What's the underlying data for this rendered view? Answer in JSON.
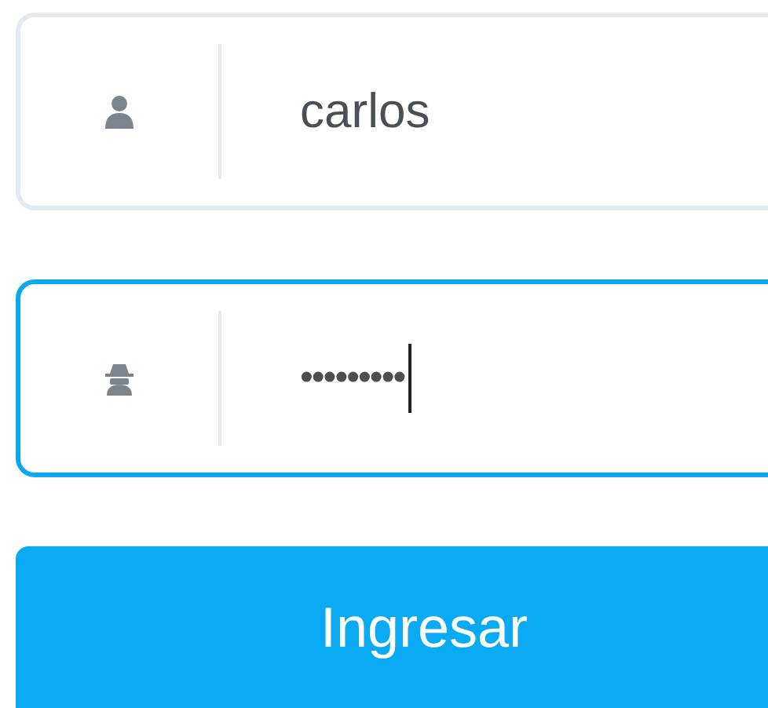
{
  "fields": [
    {
      "kind": "user",
      "value": "carlos",
      "focused": false
    },
    {
      "kind": "password",
      "value": "•••••••••",
      "focused": true
    }
  ],
  "submit_button": {
    "label": "Ingresar"
  }
}
